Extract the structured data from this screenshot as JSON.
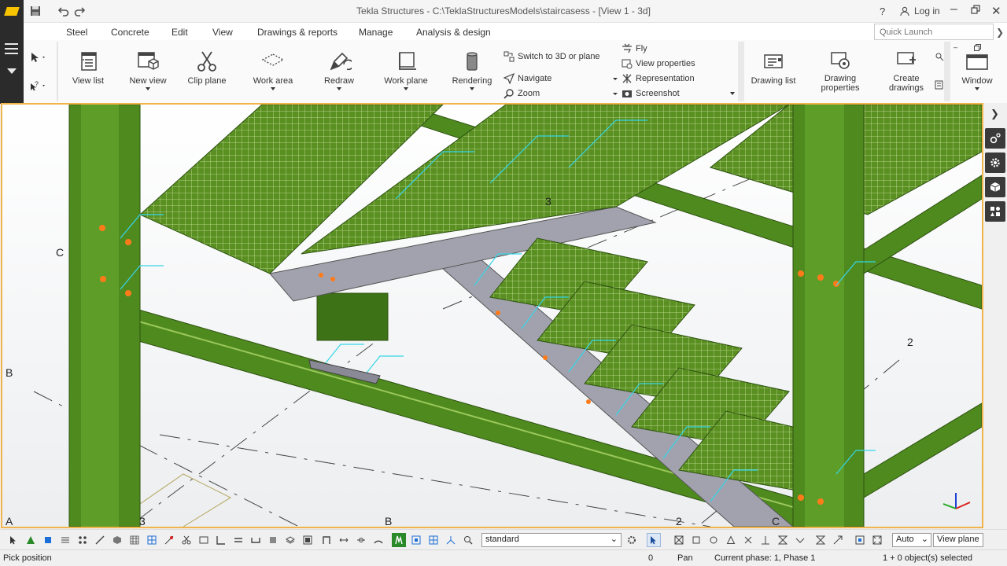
{
  "titlebar": {
    "title": "Tekla Structures - C:\\TeklaStructuresModels\\staircasess - [View 1 - 3d]",
    "help": "?",
    "user": "Log in"
  },
  "menu": {
    "items": [
      "Steel",
      "Concrete",
      "Edit",
      "View",
      "Drawings & reports",
      "Manage",
      "Analysis & design"
    ],
    "active": "View"
  },
  "quick_launch": {
    "placeholder": "Quick Launch"
  },
  "ribbon": {
    "view_list": "View list",
    "new_view": "New view",
    "clip_plane": "Clip plane",
    "work_area": "Work area",
    "redraw": "Redraw",
    "work_plane": "Work plane",
    "rendering": "Rendering",
    "switch_3d": "Switch to 3D or plane",
    "navigate": "Navigate",
    "zoom": "Zoom",
    "fly": "Fly",
    "view_properties": "View properties",
    "representation": "Representation",
    "screenshot": "Screenshot",
    "drawing_list": "Drawing list",
    "drawing_properties_1": "Drawing",
    "drawing_properties_2": "properties",
    "create_drawings_1": "Create",
    "create_drawings_2": "drawings",
    "window": "Window"
  },
  "grid_labels": {
    "c_left": "C",
    "b_left": "B",
    "a_bottom": "A",
    "three_bottom": "3",
    "b_bottom": "B",
    "two_bottom": "2",
    "c_bottom": "C",
    "two_right": "2",
    "three_top": "3"
  },
  "toolbar": {
    "filter": "standard",
    "snap_mode": "Auto",
    "plane": "View plane"
  },
  "status": {
    "prompt": "Pick position",
    "counter": "0",
    "mode": "Pan",
    "phase": "Current phase: 1, Phase 1",
    "selection": "1 + 0 object(s) selected"
  },
  "colors": {
    "steel": "#4f8a1f",
    "accent": "#f0a30a",
    "stair": "#9a9aa8",
    "bolt": "#ff7b1a",
    "dim": "#35d6e8"
  }
}
